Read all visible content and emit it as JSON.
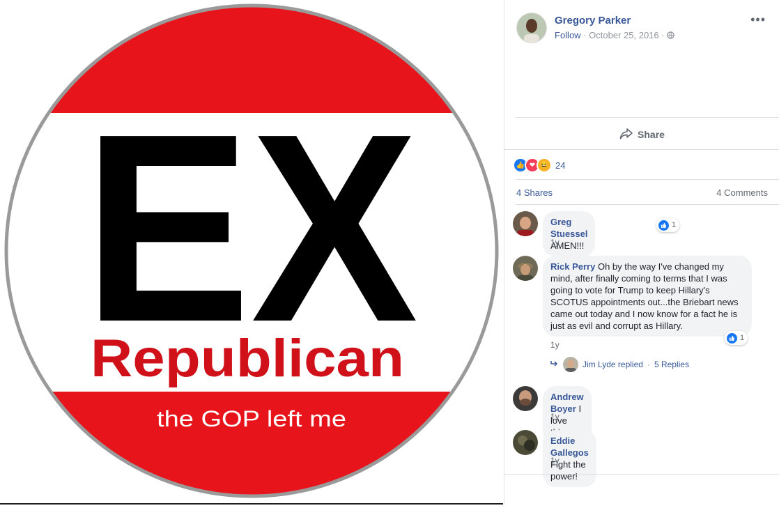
{
  "photo": {
    "big_text": "EX",
    "word": "Republican",
    "tagline": "the GOP left me",
    "colors": {
      "red": "#e8141b",
      "black": "#000000",
      "white": "#ffffff"
    }
  },
  "post": {
    "author": "Gregory Parker",
    "follow_label": "Follow",
    "date": "October 25, 2016",
    "meta_sep": "·",
    "privacy_icon": "globe-icon",
    "more_icon": "more-options-icon"
  },
  "actions": {
    "share_label": "Share"
  },
  "reactions": {
    "count": "24",
    "types": [
      "like",
      "love",
      "haha"
    ]
  },
  "stats": {
    "shares": "4 Shares",
    "comments": "4 Comments"
  },
  "comments": [
    {
      "name": "Greg Stuessel",
      "text": "AMEN!!!",
      "time": "1y",
      "likes": "1"
    },
    {
      "name": "Rick Perry",
      "text": "Oh by the way I've changed my mind, after finally coming to terms that I was going to vote for Trump to keep Hillary's SCOTUS appointments out...the Briebart news came out today and I now know for a fact he is just as evil and corrupt as Hillary.",
      "time": "1y",
      "likes": "1",
      "reply": {
        "who": "Jim Lyde replied",
        "sep": "·",
        "count": "5 Replies"
      }
    },
    {
      "name": "Andrew Boyer",
      "text": "I love this.",
      "time": "1y"
    },
    {
      "name": "Eddie Gallegos",
      "text": "Fight the power!",
      "time": "1y"
    }
  ]
}
